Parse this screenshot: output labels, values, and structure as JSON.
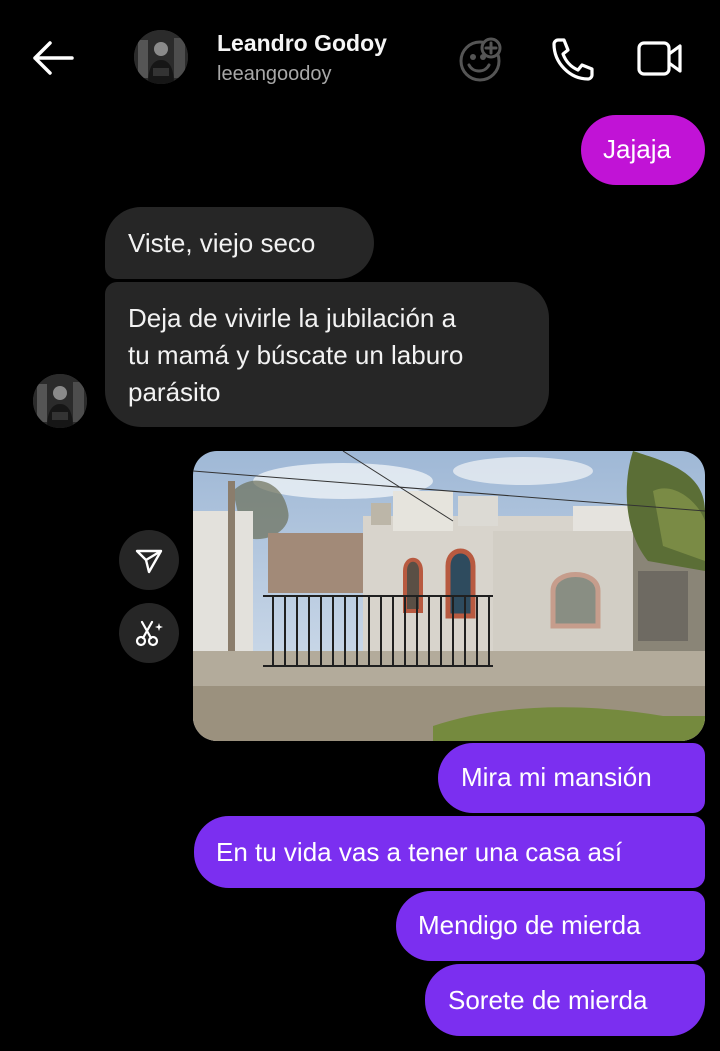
{
  "header": {
    "name": "Leandro Godoy",
    "username": "leeangoodoy",
    "back_icon": "arrow-left-icon",
    "effects_icon": "effects-icon",
    "call_icon": "phone-icon",
    "video_icon": "video-camera-icon"
  },
  "messages": {
    "m1": "Jajaja",
    "m2": "Viste, viejo seco",
    "m3_lines": [
      "Deja de vivirle la jubilación a",
      "tu mamá y búscate un laburo",
      "parásito"
    ],
    "m5": "Mira mi mansión",
    "m6": "En tu vida vas a tener una casa así",
    "m7": "Mendigo de mierda",
    "m8": "Sorete de mierda"
  },
  "actions": {
    "share_icon": "share-send-icon",
    "cutout_icon": "scissors-sparkle-icon"
  },
  "colors": {
    "background": "#000000",
    "incoming_bubble": "#262626",
    "outgoing_pink": "#c113d6",
    "outgoing_purple": "#7b2ff0",
    "username_gray": "#a8a8a8"
  }
}
